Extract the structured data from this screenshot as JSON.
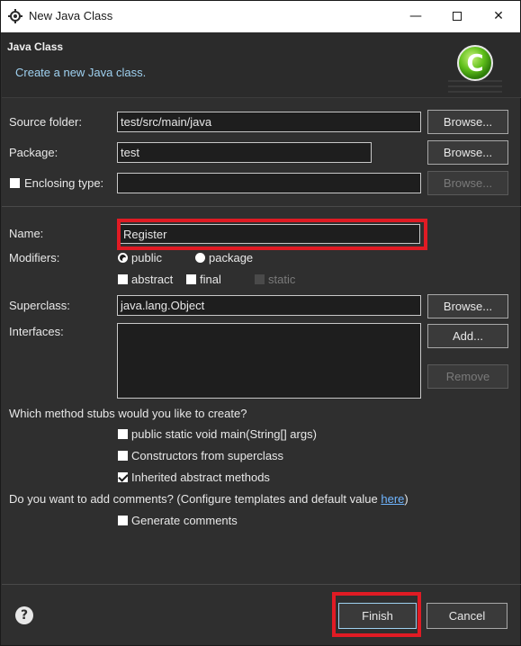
{
  "window": {
    "title": "New Java Class",
    "minimize_glyph": "—",
    "maximize_glyph": "",
    "close_glyph": "✕"
  },
  "header": {
    "title": "Java Class",
    "description": "Create a new Java class.",
    "logo_letter": "C"
  },
  "form": {
    "source_folder": {
      "label": "Source folder:",
      "value": "test/src/main/java",
      "browse": "Browse..."
    },
    "package": {
      "label": "Package:",
      "value": "test",
      "browse": "Browse..."
    },
    "enclosing_type": {
      "label": "Enclosing type:",
      "value": "",
      "browse": "Browse...",
      "checked": false
    },
    "name": {
      "label": "Name:",
      "value": "Register"
    },
    "modifiers": {
      "label": "Modifiers:",
      "public": "public",
      "package": "package",
      "abstract": "abstract",
      "final": "final",
      "static": "static",
      "selected": "public"
    },
    "superclass": {
      "label": "Superclass:",
      "value": "java.lang.Object",
      "browse": "Browse..."
    },
    "interfaces": {
      "label": "Interfaces:",
      "add": "Add...",
      "remove": "Remove"
    }
  },
  "stubs": {
    "question": "Which method stubs would you like to create?",
    "main": "public static void main(String[] args)",
    "constructors": "Constructors from superclass",
    "inherited": "Inherited abstract methods",
    "main_checked": false,
    "constructors_checked": false,
    "inherited_checked": true
  },
  "comments": {
    "question_prefix": "Do you want to add comments? (Configure templates and default value ",
    "link": "here",
    "question_suffix": ")",
    "generate": "Generate comments",
    "generate_checked": false
  },
  "footer": {
    "help": "?",
    "finish": "Finish",
    "cancel": "Cancel"
  },
  "colors": {
    "highlight": "#e01b24",
    "link": "#6fb5ff",
    "description": "#9fd1f0"
  }
}
